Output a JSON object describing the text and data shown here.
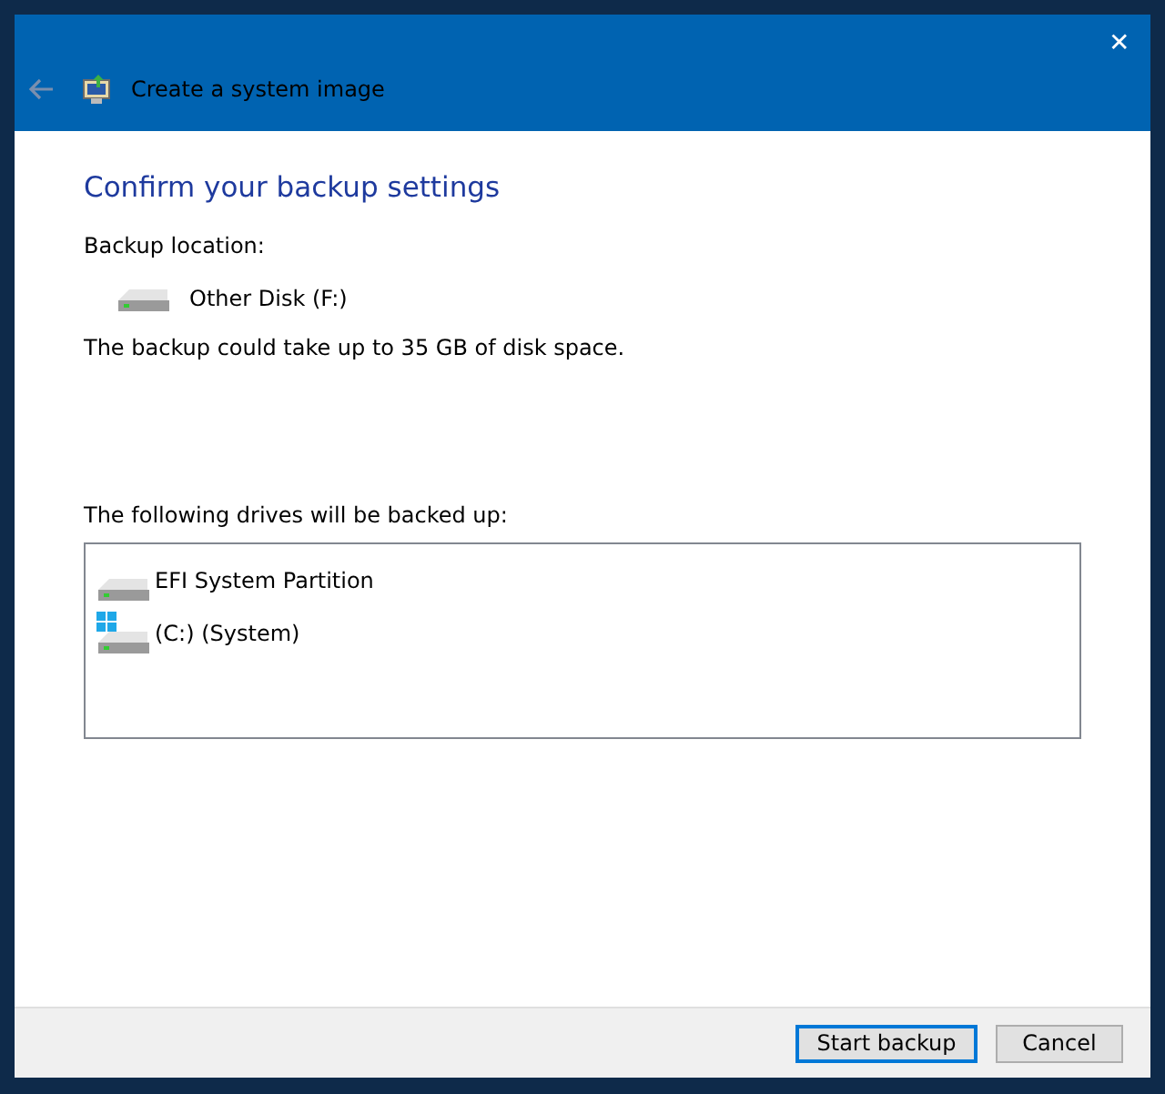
{
  "window": {
    "title": "Create a system image",
    "close": "✕"
  },
  "heading": "Confirm your backup settings",
  "location": {
    "label": "Backup location:",
    "drive": "Other Disk (F:)"
  },
  "space_note": "The backup could take up to 35 GB of disk space.",
  "drives": {
    "label": "The following drives will be backed up:",
    "items": [
      {
        "name": "EFI System Partition",
        "kind": "plain"
      },
      {
        "name": "(C:) (System)",
        "kind": "system"
      }
    ]
  },
  "buttons": [
    {
      "label": "Start backup",
      "default": true
    },
    {
      "label": "Cancel",
      "default": false
    }
  ]
}
